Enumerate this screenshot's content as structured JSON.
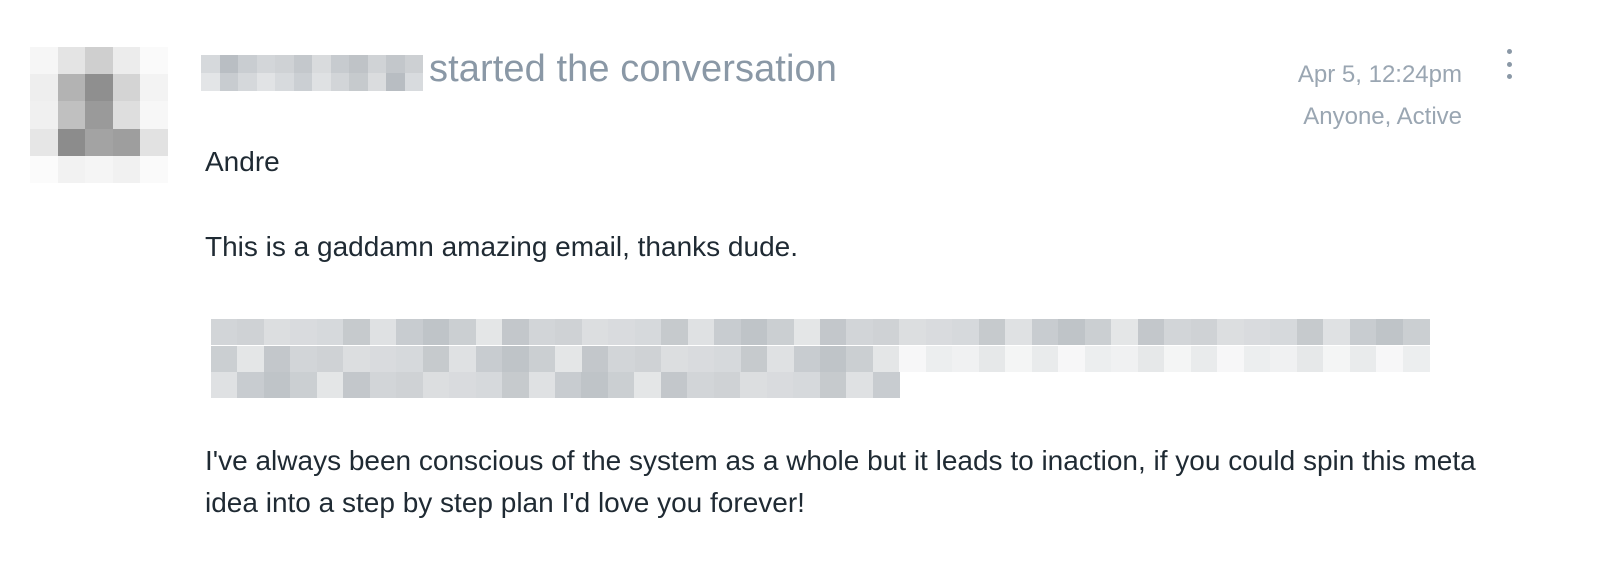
{
  "conversation_post": {
    "author_redacted": true,
    "action_text": "started the conversation",
    "timestamp": "Apr 5, 12:24pm",
    "visibility_status": "Anyone, Active",
    "menu_icon": "vertical-ellipsis-icon",
    "greeting": "Andre",
    "paragraph_1": "This is a gaddamn amazing email, thanks dude.",
    "quote_redacted": true,
    "paragraph_2": "I've always been conscious of the system as a whole but it leads to inaction, if you could spin this meta idea into a step by step plan I'd love you forever!"
  },
  "colors": {
    "text_primary": "#1f2a33",
    "text_muted": "#8a98a6",
    "meta_text": "#9aa6b2"
  }
}
